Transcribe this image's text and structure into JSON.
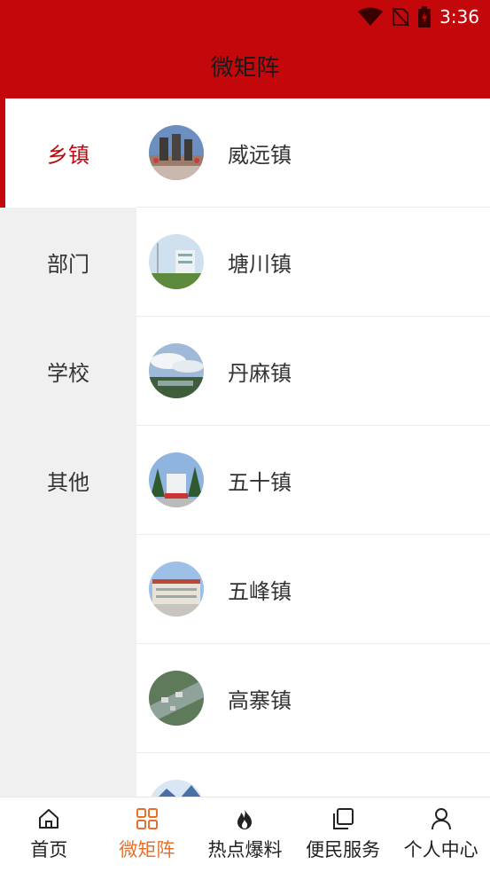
{
  "status": {
    "time": "3:36"
  },
  "header": {
    "title": "微矩阵"
  },
  "colors": {
    "brand": "#c4070b",
    "tab_active": "#e8702a"
  },
  "sidebar": {
    "items": [
      {
        "label": "乡镇",
        "active": true
      },
      {
        "label": "部门",
        "active": false
      },
      {
        "label": "学校",
        "active": false
      },
      {
        "label": "其他",
        "active": false
      }
    ]
  },
  "list": {
    "items": [
      {
        "name": "威远镇"
      },
      {
        "name": "塘川镇"
      },
      {
        "name": "丹麻镇"
      },
      {
        "name": "五十镇"
      },
      {
        "name": "五峰镇"
      },
      {
        "name": "高寨镇"
      },
      {
        "name": ""
      }
    ]
  },
  "tabbar": {
    "items": [
      {
        "label": "首页",
        "icon": "home-icon",
        "active": false
      },
      {
        "label": "微矩阵",
        "icon": "grid-icon",
        "active": true
      },
      {
        "label": "热点爆料",
        "icon": "fire-icon",
        "active": false
      },
      {
        "label": "便民服务",
        "icon": "copy-icon",
        "active": false
      },
      {
        "label": "个人中心",
        "icon": "person-icon",
        "active": false
      }
    ]
  }
}
